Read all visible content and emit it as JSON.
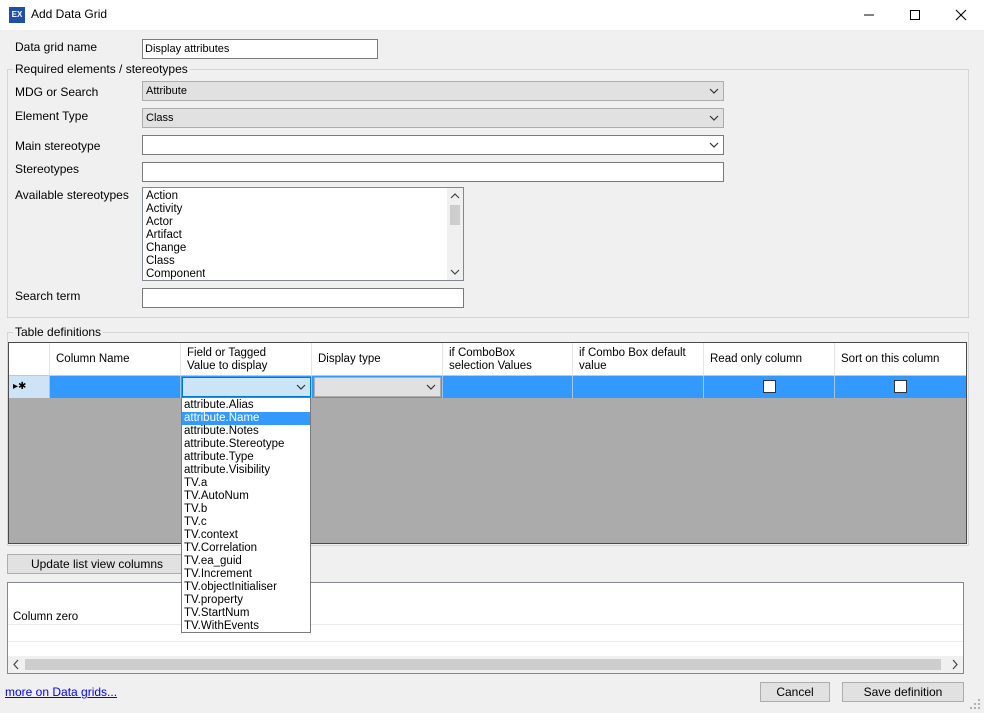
{
  "window": {
    "icon_text": "EX",
    "title": "Add Data Grid",
    "minimize_glyph": "—",
    "maximize_glyph": "☐",
    "close_glyph": "✕"
  },
  "form": {
    "grid_name_label": "Data grid name",
    "grid_name_value": "Display attributes",
    "required_group_title": "Required elements / stereotypes",
    "mdg_label": "MDG or Search",
    "mdg_value": "Attribute",
    "element_type_label": "Element Type",
    "element_type_value": "Class",
    "main_stereotype_label": "Main stereotype",
    "main_stereotype_value": "",
    "stereotypes_label": "Stereotypes",
    "stereotypes_value": "",
    "available_label": "Available stereotypes",
    "available_items": [
      "Action",
      "Activity",
      "Actor",
      "Artifact",
      "Change",
      "Class",
      "Component"
    ],
    "search_term_label": "Search term",
    "search_term_value": ""
  },
  "table": {
    "group_title": "Table definitions",
    "headers": [
      "Column Name",
      "Field or Tagged\nValue to display",
      "Display type",
      "if ComboBox\nselection Values",
      "if Combo Box default\nvalue",
      "Read only column",
      "Sort on this column"
    ],
    "row_marker": "▸✱",
    "read_only_checked": false,
    "sort_checked": false
  },
  "dropdown": {
    "items": [
      "attribute.Alias",
      "attribute.Name",
      "attribute.Notes",
      "attribute.Stereotype",
      "attribute.Type",
      "attribute.Visibility",
      "TV.a",
      "TV.AutoNum",
      "TV.b",
      "TV.c",
      "TV.context",
      "TV.Correlation",
      "TV.ea_guid",
      "TV.Increment",
      "TV.objectInitialiser",
      "TV.property",
      "TV.StartNum",
      "TV.WithEvents"
    ],
    "selected": "attribute.Name"
  },
  "bottom": {
    "update_button": "Update list view columns",
    "column_zero": "Column zero",
    "more_link": "more on Data grids...",
    "cancel_button": "Cancel",
    "save_button": "Save definition"
  },
  "colors": {
    "selection": "#3399ff",
    "grid_background": "#ababab",
    "link": "#0000ff"
  }
}
